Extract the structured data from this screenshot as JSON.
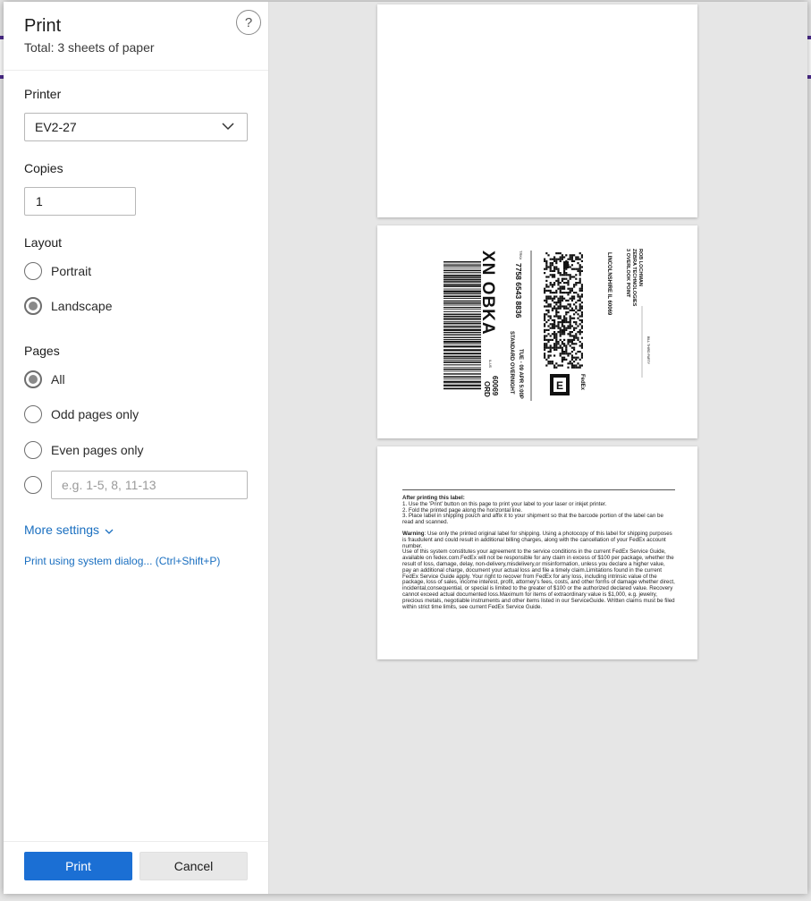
{
  "dialog": {
    "title": "Print",
    "subtitle": "Total: 3 sheets of paper",
    "help_glyph": "?"
  },
  "printer": {
    "label": "Printer",
    "value": "EV2-27"
  },
  "copies": {
    "label": "Copies",
    "value": "1"
  },
  "layout": {
    "label": "Layout",
    "options": [
      {
        "label": "Portrait",
        "checked": false
      },
      {
        "label": "Landscape",
        "checked": true
      }
    ]
  },
  "pages": {
    "label": "Pages",
    "options": [
      {
        "label": "All",
        "checked": true
      },
      {
        "label": "Odd pages only",
        "checked": false
      },
      {
        "label": "Even pages only",
        "checked": false
      }
    ],
    "custom_placeholder": "e.g. 1-5, 8, 11-13"
  },
  "links": {
    "more_settings": "More settings",
    "system_dialog": "Print using system dialog... (Ctrl+Shift+P)"
  },
  "buttons": {
    "print": "Print",
    "cancel": "Cancel"
  },
  "label_sheet": {
    "tracking": "7758 6543 8836",
    "ursa": "XN OBKA",
    "service_date": "TUE - 09 APR 5:00P",
    "service": "STANDARD OVERNIGHT",
    "zip": "60069",
    "airport": "ORD",
    "state": "IL-US",
    "to_name": "ROB LOCHMAN",
    "to_company": "ZEBRA TECHNOLOGIES",
    "to_street": "3 OVERLOOK POINT",
    "to_city": "LINCOLNSHIRE IL 60069",
    "bill": "BILL THIRD PARTY",
    "carrier_logo": "FedEx",
    "tracking_prefix": "TRK#"
  },
  "instructions": {
    "heading": "After printing this label:",
    "steps": [
      "1. Use the 'Print' button on this page to print your label to your laser or inkjet printer.",
      "2. Fold the printed page along the horizontal line.",
      "3. Place label in shipping pouch and affix it to your shipment so that the barcode portion of the label can be read and scanned."
    ],
    "warning_title": "Warning",
    "warning": ": Use only the printed original label for shipping. Using a photocopy of this label for shipping purposes is fraudulent and could result in additional billing charges, along with the cancellation of your FedEx account number.",
    "terms": "Use of this system constitutes your agreement to the service conditions in the current FedEx Service Guide, available on fedex.com.FedEx will not be responsible for any claim in excess of $100 per package, whether the result of loss, damage, delay, non-delivery,misdelivery,or misinformation, unless you declare a higher value, pay an additional charge, document your actual loss and file a timely claim.Limitations found in the current FedEx Service Guide apply. Your right to recover from FedEx for any loss, including intrinsic value of the package, loss of sales, income interest, profit, attorney's fees, costs, and other forms of damage whether direct, incidental,consequential, or special is limited to the greater of $100 or the authorized declared value. Recovery cannot exceed actual documented loss.Maximum for items of extraordinary value is $1,000, e.g. jewelry, precious metals, negotiable instruments and other items listed in our ServiceGuide. Written claims must be filed within strict time limits, see current FedEx Service Guide."
  }
}
